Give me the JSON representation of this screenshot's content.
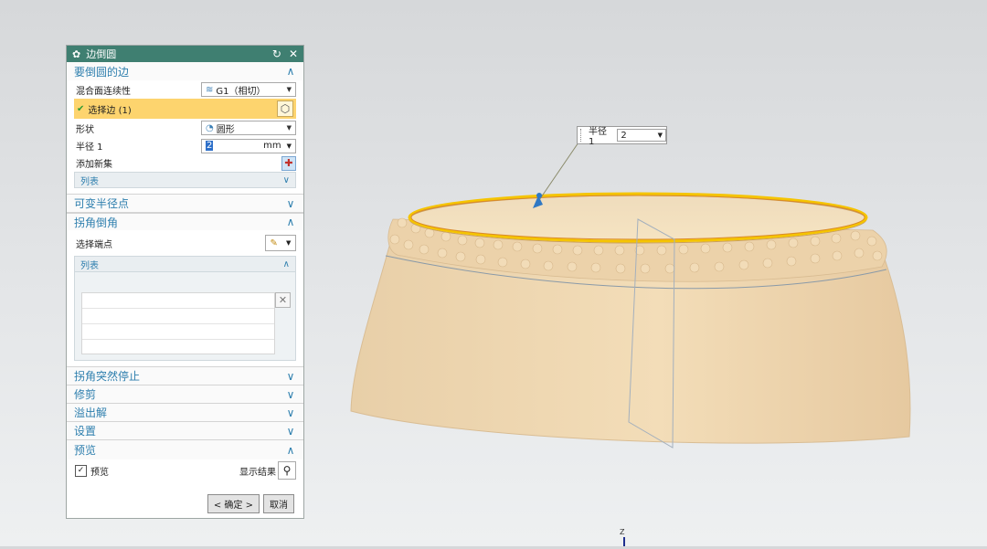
{
  "dialog": {
    "title": "边倒圆",
    "sections": {
      "edges": {
        "header": "要倒圆的边",
        "continuity_label": "混合面连续性",
        "continuity_value": "G1（相切）",
        "select_edge_label": "选择边 (1)",
        "shape_label": "形状",
        "shape_value": "圆形",
        "radius_label": "半径 1",
        "radius_value": "2",
        "radius_unit": "mm",
        "add_set_label": "添加新集",
        "list_label": "列表"
      },
      "variable_radius": {
        "header": "可变半径点"
      },
      "corner_setback": {
        "header": "拐角倒角",
        "select_endpoint_label": "选择端点",
        "list_label": "列表"
      },
      "corner_stop": {
        "header": "拐角突然停止"
      },
      "trim": {
        "header": "修剪"
      },
      "overflow": {
        "header": "溢出解"
      },
      "settings": {
        "header": "设置"
      },
      "preview": {
        "header": "预览",
        "preview_label": "预览",
        "show_result_label": "显示结果"
      }
    },
    "buttons": {
      "ok": "< 确定 >",
      "cancel": "取消"
    }
  },
  "viewport": {
    "radius_callout": {
      "label": "半径 1",
      "value": "2"
    },
    "axis_label": "Z"
  },
  "colors": {
    "titlebar": "#3f7f71",
    "section_text": "#2e7fae",
    "selection_highlight": "#fdd46e",
    "edge_highlight": "#f5c400",
    "part_body": "#eed6b0"
  }
}
